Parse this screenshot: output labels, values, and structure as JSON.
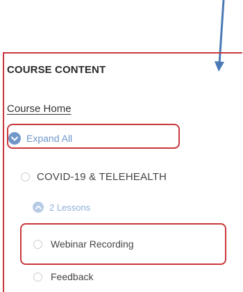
{
  "sidebar": {
    "heading": "COURSE CONTENT",
    "course_home": "Course Home",
    "expand_all": "Expand All",
    "topic": {
      "label": "COVID-19 & TELEHEALTH",
      "lessons_count": "2 Lessons",
      "lessons": [
        {
          "label": "Webinar Recording"
        },
        {
          "label": "Feedback"
        }
      ]
    }
  },
  "colors": {
    "annotation_red": "#c9373a",
    "annotation_arrow": "#4a79b5",
    "accent_blue": "#6f97c9",
    "accent_light_blue": "#b8cbe5"
  },
  "icons": {
    "expand": "chevron-down-icon",
    "collapse": "chevron-up-icon",
    "pointer": "arrow-down-icon"
  }
}
